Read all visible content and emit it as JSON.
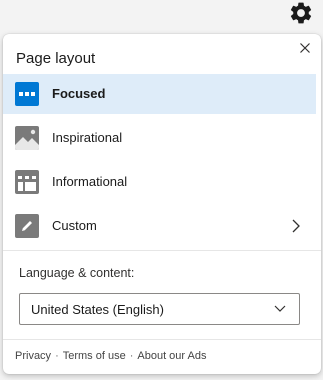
{
  "panel": {
    "title": "Page layout"
  },
  "layouts": [
    {
      "label": "Focused",
      "icon": "focused-layout-icon",
      "selected": true
    },
    {
      "label": "Inspirational",
      "icon": "inspirational-layout-icon",
      "selected": false
    },
    {
      "label": "Informational",
      "icon": "informational-layout-icon",
      "selected": false
    },
    {
      "label": "Custom",
      "icon": "custom-layout-icon",
      "selected": false
    }
  ],
  "language": {
    "label": "Language & content:",
    "selected": "United States (English)"
  },
  "footer": {
    "privacy": "Privacy",
    "terms": "Terms of use",
    "ads": "About our Ads",
    "separator": "·"
  },
  "colors": {
    "accent": "#0078d4",
    "selected_bg": "#deecf9",
    "icon_gray": "#7a7a7a"
  }
}
